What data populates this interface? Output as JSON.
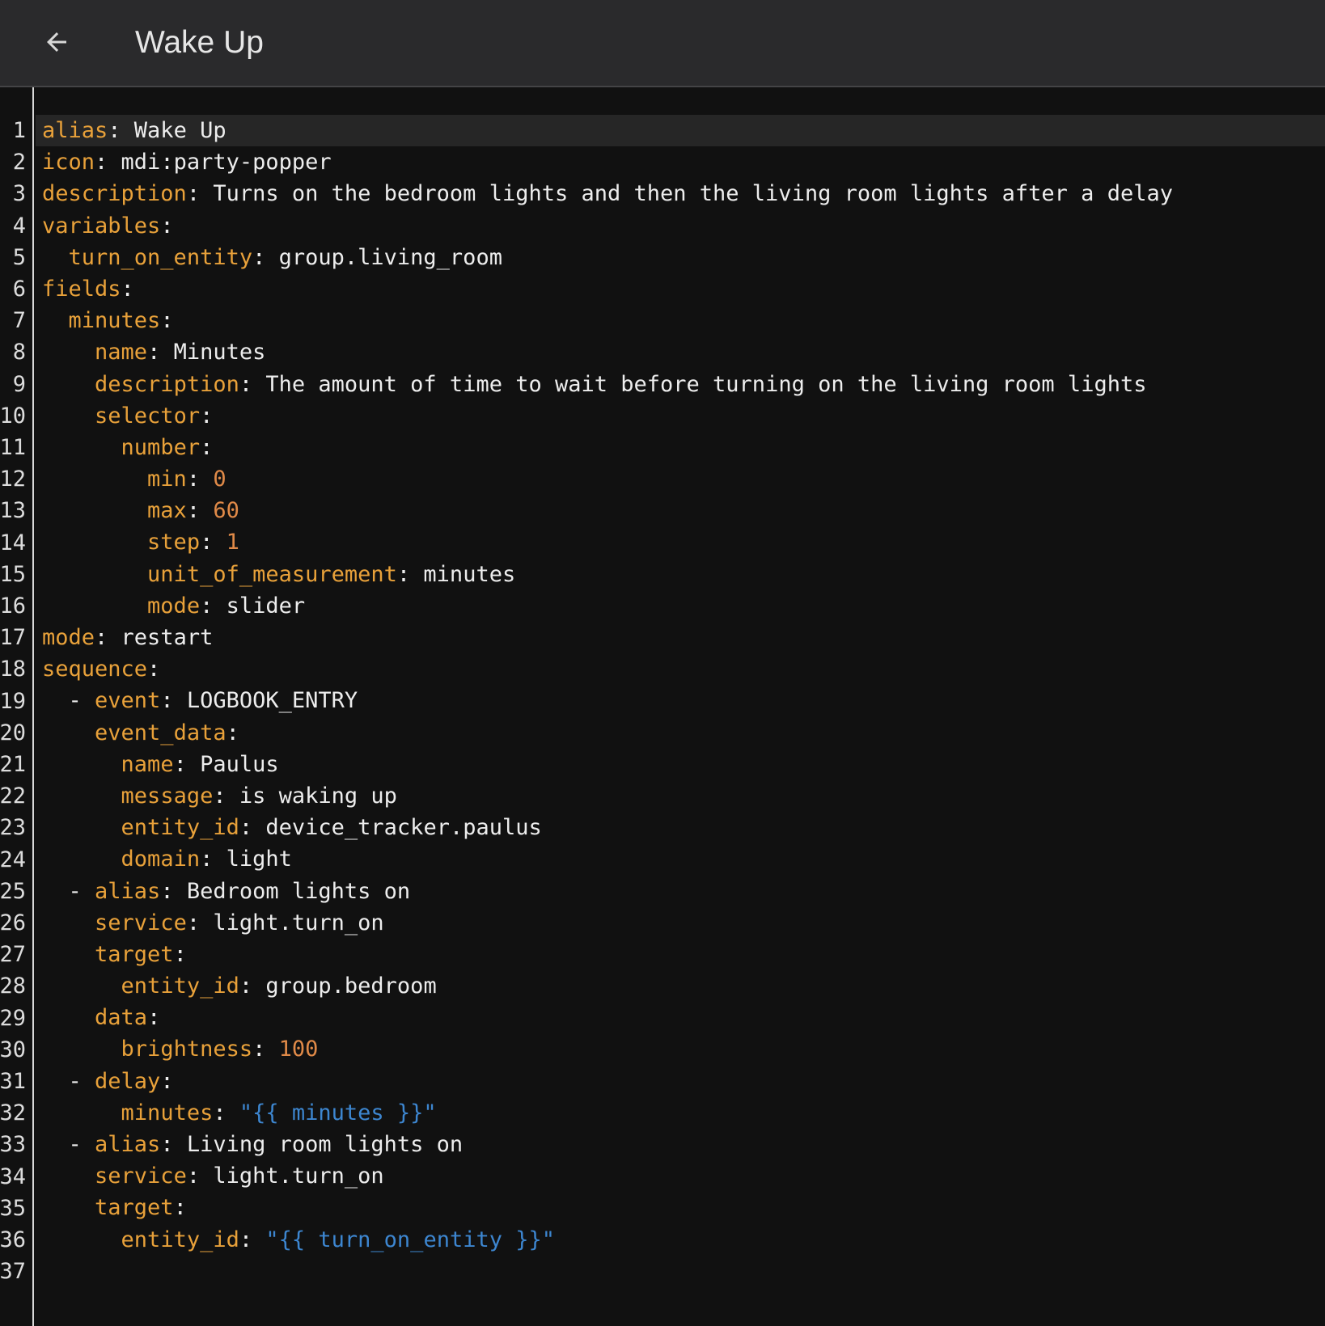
{
  "toolbar": {
    "title": "Wake Up",
    "back_icon": "arrow-left-icon"
  },
  "colors": {
    "key": "#e8a13a",
    "number": "#e08a48",
    "string": "#3d86d0",
    "text": "#ededed",
    "background": "#111111",
    "toolbar": "#2a2a2c"
  },
  "editor": {
    "active_line": 1,
    "lines": [
      [
        {
          "t": "k",
          "v": "alias"
        },
        {
          "t": "p",
          "v": ": "
        },
        {
          "t": "v",
          "v": "Wake Up"
        }
      ],
      [
        {
          "t": "k",
          "v": "icon"
        },
        {
          "t": "p",
          "v": ": "
        },
        {
          "t": "v",
          "v": "mdi:party-popper"
        }
      ],
      [
        {
          "t": "k",
          "v": "description"
        },
        {
          "t": "p",
          "v": ": "
        },
        {
          "t": "v",
          "v": "Turns on the bedroom lights and then the living room lights after a delay"
        }
      ],
      [
        {
          "t": "k",
          "v": "variables"
        },
        {
          "t": "p",
          "v": ":"
        }
      ],
      [
        {
          "t": "p",
          "v": "  "
        },
        {
          "t": "k",
          "v": "turn_on_entity"
        },
        {
          "t": "p",
          "v": ": "
        },
        {
          "t": "v",
          "v": "group.living_room"
        }
      ],
      [
        {
          "t": "k",
          "v": "fields"
        },
        {
          "t": "p",
          "v": ":"
        }
      ],
      [
        {
          "t": "p",
          "v": "  "
        },
        {
          "t": "k",
          "v": "minutes"
        },
        {
          "t": "p",
          "v": ":"
        }
      ],
      [
        {
          "t": "p",
          "v": "    "
        },
        {
          "t": "k",
          "v": "name"
        },
        {
          "t": "p",
          "v": ": "
        },
        {
          "t": "v",
          "v": "Minutes"
        }
      ],
      [
        {
          "t": "p",
          "v": "    "
        },
        {
          "t": "k",
          "v": "description"
        },
        {
          "t": "p",
          "v": ": "
        },
        {
          "t": "v",
          "v": "The amount of time to wait before turning on the living room lights"
        }
      ],
      [
        {
          "t": "p",
          "v": "    "
        },
        {
          "t": "k",
          "v": "selector"
        },
        {
          "t": "p",
          "v": ":"
        }
      ],
      [
        {
          "t": "p",
          "v": "      "
        },
        {
          "t": "k",
          "v": "number"
        },
        {
          "t": "p",
          "v": ":"
        }
      ],
      [
        {
          "t": "p",
          "v": "        "
        },
        {
          "t": "k",
          "v": "min"
        },
        {
          "t": "p",
          "v": ": "
        },
        {
          "t": "n",
          "v": "0"
        }
      ],
      [
        {
          "t": "p",
          "v": "        "
        },
        {
          "t": "k",
          "v": "max"
        },
        {
          "t": "p",
          "v": ": "
        },
        {
          "t": "n",
          "v": "60"
        }
      ],
      [
        {
          "t": "p",
          "v": "        "
        },
        {
          "t": "k",
          "v": "step"
        },
        {
          "t": "p",
          "v": ": "
        },
        {
          "t": "n",
          "v": "1"
        }
      ],
      [
        {
          "t": "p",
          "v": "        "
        },
        {
          "t": "k",
          "v": "unit_of_measurement"
        },
        {
          "t": "p",
          "v": ": "
        },
        {
          "t": "v",
          "v": "minutes"
        }
      ],
      [
        {
          "t": "p",
          "v": "        "
        },
        {
          "t": "k",
          "v": "mode"
        },
        {
          "t": "p",
          "v": ": "
        },
        {
          "t": "v",
          "v": "slider"
        }
      ],
      [
        {
          "t": "k",
          "v": "mode"
        },
        {
          "t": "p",
          "v": ": "
        },
        {
          "t": "v",
          "v": "restart"
        }
      ],
      [
        {
          "t": "k",
          "v": "sequence"
        },
        {
          "t": "p",
          "v": ":"
        }
      ],
      [
        {
          "t": "p",
          "v": "  - "
        },
        {
          "t": "k",
          "v": "event"
        },
        {
          "t": "p",
          "v": ": "
        },
        {
          "t": "v",
          "v": "LOGBOOK_ENTRY"
        }
      ],
      [
        {
          "t": "p",
          "v": "    "
        },
        {
          "t": "k",
          "v": "event_data"
        },
        {
          "t": "p",
          "v": ":"
        }
      ],
      [
        {
          "t": "p",
          "v": "      "
        },
        {
          "t": "k",
          "v": "name"
        },
        {
          "t": "p",
          "v": ": "
        },
        {
          "t": "v",
          "v": "Paulus"
        }
      ],
      [
        {
          "t": "p",
          "v": "      "
        },
        {
          "t": "k",
          "v": "message"
        },
        {
          "t": "p",
          "v": ": "
        },
        {
          "t": "v",
          "v": "is waking up"
        }
      ],
      [
        {
          "t": "p",
          "v": "      "
        },
        {
          "t": "k",
          "v": "entity_id"
        },
        {
          "t": "p",
          "v": ": "
        },
        {
          "t": "v",
          "v": "device_tracker.paulus"
        }
      ],
      [
        {
          "t": "p",
          "v": "      "
        },
        {
          "t": "k",
          "v": "domain"
        },
        {
          "t": "p",
          "v": ": "
        },
        {
          "t": "v",
          "v": "light"
        }
      ],
      [
        {
          "t": "p",
          "v": "  - "
        },
        {
          "t": "k",
          "v": "alias"
        },
        {
          "t": "p",
          "v": ": "
        },
        {
          "t": "v",
          "v": "Bedroom lights on"
        }
      ],
      [
        {
          "t": "p",
          "v": "    "
        },
        {
          "t": "k",
          "v": "service"
        },
        {
          "t": "p",
          "v": ": "
        },
        {
          "t": "v",
          "v": "light.turn_on"
        }
      ],
      [
        {
          "t": "p",
          "v": "    "
        },
        {
          "t": "k",
          "v": "target"
        },
        {
          "t": "p",
          "v": ":"
        }
      ],
      [
        {
          "t": "p",
          "v": "      "
        },
        {
          "t": "k",
          "v": "entity_id"
        },
        {
          "t": "p",
          "v": ": "
        },
        {
          "t": "v",
          "v": "group.bedroom"
        }
      ],
      [
        {
          "t": "p",
          "v": "    "
        },
        {
          "t": "k",
          "v": "data"
        },
        {
          "t": "p",
          "v": ":"
        }
      ],
      [
        {
          "t": "p",
          "v": "      "
        },
        {
          "t": "k",
          "v": "brightness"
        },
        {
          "t": "p",
          "v": ": "
        },
        {
          "t": "n",
          "v": "100"
        }
      ],
      [
        {
          "t": "p",
          "v": "  - "
        },
        {
          "t": "k",
          "v": "delay"
        },
        {
          "t": "p",
          "v": ":"
        }
      ],
      [
        {
          "t": "p",
          "v": "      "
        },
        {
          "t": "k",
          "v": "minutes"
        },
        {
          "t": "p",
          "v": ": "
        },
        {
          "t": "s",
          "v": "\"{{ minutes }}\""
        }
      ],
      [
        {
          "t": "p",
          "v": "  - "
        },
        {
          "t": "k",
          "v": "alias"
        },
        {
          "t": "p",
          "v": ": "
        },
        {
          "t": "v",
          "v": "Living room lights on"
        }
      ],
      [
        {
          "t": "p",
          "v": "    "
        },
        {
          "t": "k",
          "v": "service"
        },
        {
          "t": "p",
          "v": ": "
        },
        {
          "t": "v",
          "v": "light.turn_on"
        }
      ],
      [
        {
          "t": "p",
          "v": "    "
        },
        {
          "t": "k",
          "v": "target"
        },
        {
          "t": "p",
          "v": ":"
        }
      ],
      [
        {
          "t": "p",
          "v": "      "
        },
        {
          "t": "k",
          "v": "entity_id"
        },
        {
          "t": "p",
          "v": ": "
        },
        {
          "t": "s",
          "v": "\"{{ turn_on_entity }}\""
        }
      ],
      []
    ]
  }
}
